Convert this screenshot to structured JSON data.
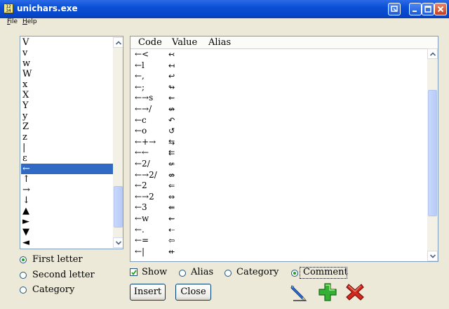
{
  "window": {
    "title": "unichars.exe",
    "app_icon_glyphs": "123\n456"
  },
  "menu": [
    {
      "label": "File"
    },
    {
      "label": "Help"
    }
  ],
  "letters": {
    "items": [
      "V",
      "v",
      "w",
      "W",
      "x",
      "X",
      "Y",
      "y",
      "Z",
      "z",
      "|",
      "ε",
      "←",
      "↑",
      "→",
      "↓",
      "▲",
      "►",
      "▼",
      "◄"
    ],
    "selected_index": 12,
    "scroll": {
      "thumb_start": 0.73,
      "thumb_size": 0.22
    }
  },
  "letter_mode": {
    "options": [
      {
        "label": "First letter",
        "selected": true
      },
      {
        "label": "Second letter",
        "selected": false
      },
      {
        "label": "Category",
        "selected": false
      }
    ]
  },
  "table": {
    "columns": [
      "Code",
      "Value",
      "Alias"
    ],
    "rows": [
      {
        "code": "←<",
        "value": "↢"
      },
      {
        "code": "←l",
        "value": "↤"
      },
      {
        "code": "←,",
        "value": "↩"
      },
      {
        "code": "←;",
        "value": "↬"
      },
      {
        "code": "←→s",
        "value": "⇜"
      },
      {
        "code": "←→/",
        "value": "↮"
      },
      {
        "code": "←c",
        "value": "↶"
      },
      {
        "code": "←o",
        "value": "↺"
      },
      {
        "code": "←+→",
        "value": "⇆"
      },
      {
        "code": "←←",
        "value": "⇇"
      },
      {
        "code": "←2/",
        "value": "⇍"
      },
      {
        "code": "←→2/",
        "value": "⇎"
      },
      {
        "code": "←2",
        "value": "⇐"
      },
      {
        "code": "←→2",
        "value": "⇔"
      },
      {
        "code": "←3",
        "value": "⇚"
      },
      {
        "code": "←w",
        "value": "⇜"
      },
      {
        "code": "←.",
        "value": "⇠"
      },
      {
        "code": "←=",
        "value": "⇦"
      },
      {
        "code": "←|",
        "value": "⇷"
      }
    ],
    "scroll": {
      "thumb_start": 0.16,
      "thumb_size": 0.66
    }
  },
  "show": {
    "label": "Show",
    "checked": true
  },
  "show_mode": {
    "options": [
      {
        "label": "Alias",
        "selected": false
      },
      {
        "label": "Category",
        "selected": false
      },
      {
        "label": "Comment",
        "selected": true
      }
    ]
  },
  "buttons": {
    "insert": "Insert",
    "close": "Close"
  },
  "tools": [
    {
      "name": "edit-pencil-icon",
      "color": "#2f6fd8"
    },
    {
      "name": "add-plus-icon",
      "color": "#2ea52e"
    },
    {
      "name": "delete-x-icon",
      "color": "#d42a1e"
    }
  ]
}
